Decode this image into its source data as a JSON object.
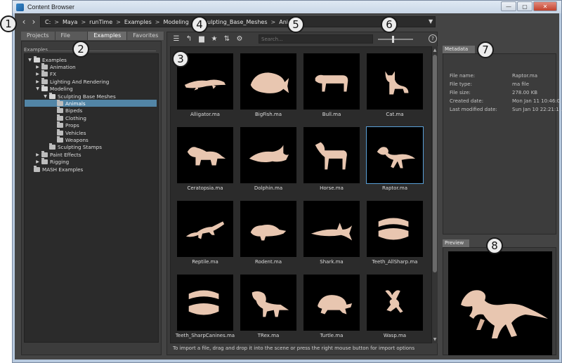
{
  "window": {
    "title": "Content Browser",
    "buttons": {
      "minimize": "—",
      "maximize": "▢",
      "close": "✕"
    }
  },
  "nav": {
    "back": "‹",
    "forward": "›"
  },
  "breadcrumb": {
    "items": [
      "C:",
      "Maya",
      "runTime",
      "Examples",
      "Modeling",
      "Sculpting_Base_Meshes",
      "Animals"
    ],
    "separator": ">",
    "dropdown": "▼"
  },
  "left": {
    "tabs": [
      "Projects",
      "File System",
      "Examples",
      "Favorites"
    ],
    "active_tab": "Examples",
    "tree_header": "Examples",
    "tree": [
      {
        "label": "Examples",
        "depth": 0,
        "expanded": true,
        "has_children": true
      },
      {
        "label": "Animation",
        "depth": 1,
        "expanded": false,
        "has_children": true
      },
      {
        "label": "FX",
        "depth": 1,
        "expanded": false,
        "has_children": true
      },
      {
        "label": "Lighting And Rendering",
        "depth": 1,
        "expanded": false,
        "has_children": true
      },
      {
        "label": "Modeling",
        "depth": 1,
        "expanded": true,
        "has_children": true
      },
      {
        "label": "Sculpting Base Meshes",
        "depth": 2,
        "expanded": true,
        "has_children": true
      },
      {
        "label": "Animals",
        "depth": 3,
        "expanded": false,
        "has_children": false,
        "selected": true
      },
      {
        "label": "Bipeds",
        "depth": 3,
        "expanded": false,
        "has_children": false
      },
      {
        "label": "Clothing",
        "depth": 3,
        "expanded": false,
        "has_children": false
      },
      {
        "label": "Props",
        "depth": 3,
        "expanded": false,
        "has_children": false
      },
      {
        "label": "Vehicles",
        "depth": 3,
        "expanded": false,
        "has_children": false
      },
      {
        "label": "Weapons",
        "depth": 3,
        "expanded": false,
        "has_children": false
      },
      {
        "label": "Sculpting Stamps",
        "depth": 2,
        "expanded": false,
        "has_children": false
      },
      {
        "label": "Paint Effects",
        "depth": 1,
        "expanded": false,
        "has_children": true
      },
      {
        "label": "Rigging",
        "depth": 1,
        "expanded": false,
        "has_children": true
      },
      {
        "label": "MASH Examples",
        "depth": 0,
        "expanded": false,
        "has_children": false
      }
    ]
  },
  "toolbar": {
    "icons": [
      {
        "name": "list-view-icon",
        "glyph": "☰"
      },
      {
        "name": "go-up-icon",
        "glyph": "↰"
      },
      {
        "name": "folder-icon",
        "glyph": "▆"
      },
      {
        "name": "favorite-star-icon",
        "glyph": "★"
      },
      {
        "name": "sort-icon",
        "glyph": "⇅"
      },
      {
        "name": "settings-gear-icon",
        "glyph": "⚙"
      }
    ],
    "search_placeholder": "Search...",
    "help": "?"
  },
  "files": [
    {
      "name": "Alligator.ma",
      "shape": "alligator"
    },
    {
      "name": "BigFish.ma",
      "shape": "fish"
    },
    {
      "name": "Bull.ma",
      "shape": "bull"
    },
    {
      "name": "Cat.ma",
      "shape": "cat"
    },
    {
      "name": "Ceratopsia.ma",
      "shape": "dino"
    },
    {
      "name": "Dolphin.ma",
      "shape": "dolphin"
    },
    {
      "name": "Horse.ma",
      "shape": "horse"
    },
    {
      "name": "Raptor.ma",
      "shape": "raptor",
      "selected": true
    },
    {
      "name": "Reptile.ma",
      "shape": "lizard"
    },
    {
      "name": "Rodent.ma",
      "shape": "rodent"
    },
    {
      "name": "Shark.ma",
      "shape": "shark"
    },
    {
      "name": "Teeth_AllSharp.ma",
      "shape": "teeth"
    },
    {
      "name": "Teeth_SharpCanines.ma",
      "shape": "teeth2"
    },
    {
      "name": "TRex.ma",
      "shape": "trex"
    },
    {
      "name": "Turtle.ma",
      "shape": "turtle"
    },
    {
      "name": "Wasp.ma",
      "shape": "wasp"
    }
  ],
  "status_text": "To import a file, drag and drop it into the scene or press the right mouse button for import options",
  "metadata": {
    "tab": "Metadata",
    "rows": [
      {
        "label": "File name:",
        "value": "Raptor.ma"
      },
      {
        "label": "File type:",
        "value": "ma file"
      },
      {
        "label": "File size:",
        "value": "278.00 KB"
      },
      {
        "label": "Created date:",
        "value": "Mon Jan 11 10:46:0..."
      },
      {
        "label": "Last modified date:",
        "value": "Sun Jan 10 22:21:1..."
      }
    ]
  },
  "preview": {
    "tab": "Preview"
  },
  "callouts": [
    "1",
    "2",
    "3",
    "4",
    "5",
    "6",
    "7",
    "8"
  ],
  "colors": {
    "selection": "#5285a6",
    "model": "#e8c6b0",
    "panel_bg": "#444444"
  }
}
